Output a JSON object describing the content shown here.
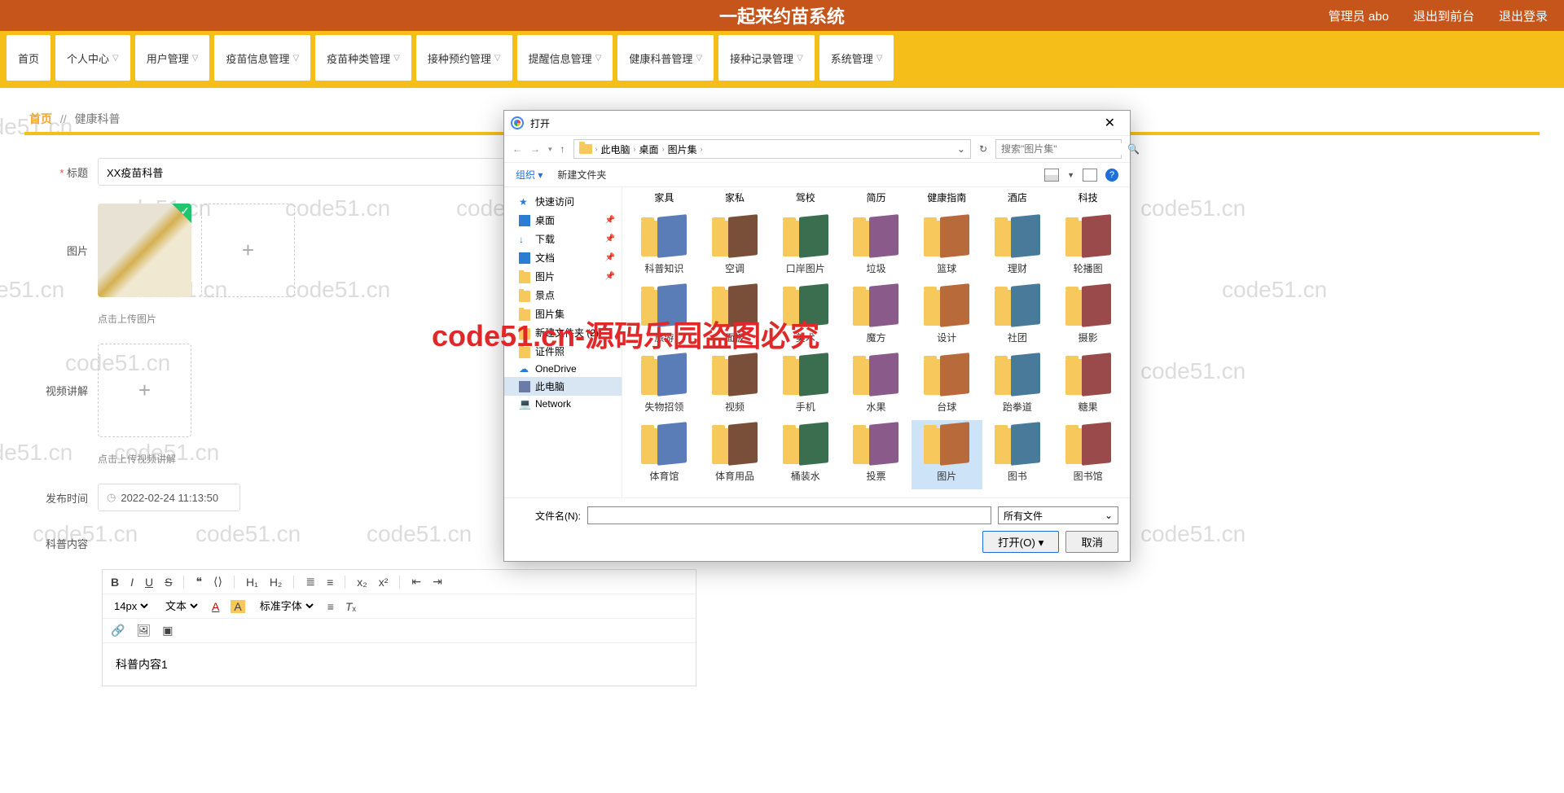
{
  "watermark": "code51.cn",
  "overlay": "code51.cn-源码乐园盗图必究",
  "header": {
    "title": "一起来约苗系统",
    "admin": "管理员 abo",
    "logout_front": "退出到前台",
    "logout": "退出登录"
  },
  "nav": {
    "items": [
      {
        "label": "首页",
        "dd": false
      },
      {
        "label": "个人中心",
        "dd": true
      },
      {
        "label": "用户管理",
        "dd": true
      },
      {
        "label": "疫苗信息管理",
        "dd": true
      },
      {
        "label": "疫苗种类管理",
        "dd": true
      },
      {
        "label": "接种预约管理",
        "dd": true
      },
      {
        "label": "提醒信息管理",
        "dd": true
      },
      {
        "label": "健康科普管理",
        "dd": true
      },
      {
        "label": "接种记录管理",
        "dd": true
      },
      {
        "label": "系统管理",
        "dd": true
      }
    ]
  },
  "breadcrumb": {
    "home": "首页",
    "sep": "//",
    "current": "健康科普"
  },
  "form": {
    "title_label": "标题",
    "title_value": "XX疫苗科普",
    "image_label": "图片",
    "image_hint": "点击上传图片",
    "video_label": "视频讲解",
    "video_hint": "点击上传视频讲解",
    "pubtime_label": "发布时间",
    "pubtime_value": "2022-02-24 11:13:50",
    "content_label": "科普内容",
    "content_value": "科普内容1",
    "fontsize": "14px",
    "fontfamily": "文本",
    "fontdefault": "标准字体"
  },
  "dialog": {
    "title": "打开",
    "path": [
      "此电脑",
      "桌面",
      "图片集"
    ],
    "search_placeholder": "搜索\"图片集\"",
    "organize": "组织",
    "new_folder": "新建文件夹",
    "tree": [
      {
        "label": "快速访问",
        "icon": "star"
      },
      {
        "label": "桌面",
        "icon": "desk",
        "pin": true
      },
      {
        "label": "下载",
        "icon": "down",
        "pin": true
      },
      {
        "label": "文档",
        "icon": "doc",
        "pin": true
      },
      {
        "label": "图片",
        "icon": "fold",
        "pin": true
      },
      {
        "label": "景点",
        "icon": "fold"
      },
      {
        "label": "图片集",
        "icon": "fold"
      },
      {
        "label": "新建文件夹 (2)",
        "icon": "fold"
      },
      {
        "label": "证件照",
        "icon": "fold"
      },
      {
        "label": "OneDrive",
        "icon": "cloud"
      },
      {
        "label": "此电脑",
        "icon": "pc",
        "sel": true
      },
      {
        "label": "Network",
        "icon": "net"
      }
    ],
    "top_labels": [
      "家具",
      "家私",
      "驾校",
      "简历",
      "健康指南",
      "酒店",
      "科技"
    ],
    "folders": [
      "科普知识",
      "空调",
      "口岸图片",
      "垃圾",
      "篮球",
      "理财",
      "轮播图",
      "旅游",
      "面板",
      "美术",
      "魔方",
      "设计",
      "社团",
      "摄影",
      "失物招领",
      "视频",
      "手机",
      "水果",
      "台球",
      "跆拳道",
      "糖果",
      "体育馆",
      "体育用品",
      "桶装水",
      "投票",
      "图片",
      "图书",
      "图书馆"
    ],
    "selected_idx": 25,
    "filename_label": "文件名(N):",
    "filetype": "所有文件",
    "open_btn": "打开(O)",
    "cancel_btn": "取消"
  }
}
